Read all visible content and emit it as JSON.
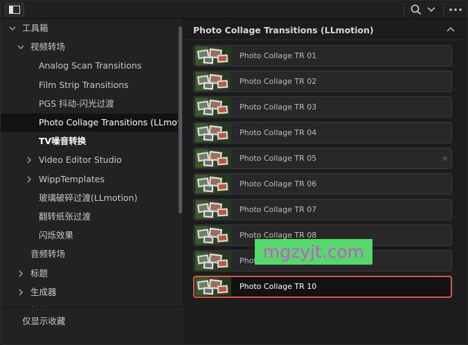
{
  "tree": {
    "items": [
      {
        "label": "工具箱",
        "level": 0,
        "arrow": "down",
        "state": "normal"
      },
      {
        "label": "视频转场",
        "level": 1,
        "arrow": "down",
        "state": "normal"
      },
      {
        "label": "Analog Scan Transitions",
        "level": 2,
        "arrow": "none",
        "state": "normal"
      },
      {
        "label": "Film Strip Transitions",
        "level": 2,
        "arrow": "none",
        "state": "normal"
      },
      {
        "label": "PGS 抖动-闪光过渡",
        "level": 2,
        "arrow": "none",
        "state": "normal"
      },
      {
        "label": "Photo Collage Transitions (LLmoti...",
        "level": 2,
        "arrow": "none",
        "state": "selected"
      },
      {
        "label": "TV噪音转换",
        "level": 2,
        "arrow": "none",
        "state": "bold"
      },
      {
        "label": "Video Editor Studio",
        "level": 2,
        "arrow": "right",
        "state": "normal"
      },
      {
        "label": "WippTemplates",
        "level": 2,
        "arrow": "right",
        "state": "normal"
      },
      {
        "label": "玻璃破碎过渡(LLmotion)",
        "level": 2,
        "arrow": "none",
        "state": "normal"
      },
      {
        "label": "翻转纸张过渡",
        "level": 2,
        "arrow": "none",
        "state": "normal"
      },
      {
        "label": "闪烁效果",
        "level": 2,
        "arrow": "none",
        "state": "normal"
      },
      {
        "label": "音频转场",
        "level": 1,
        "arrow": "none",
        "state": "normal"
      },
      {
        "label": "标题",
        "level": 1,
        "arrow": "right",
        "state": "normal"
      },
      {
        "label": "生成器",
        "level": 1,
        "arrow": "right",
        "state": "normal"
      },
      {
        "label": "特效",
        "level": 1,
        "arrow": "right",
        "state": "normal"
      }
    ],
    "footer_label": "仅显示收藏"
  },
  "panel": {
    "title": "Photo Collage Transitions (LLmotion)",
    "cards": [
      {
        "label": "Photo Collage TR 01",
        "active": false,
        "favorite_visible": false
      },
      {
        "label": "Photo Collage TR 02",
        "active": false,
        "favorite_visible": false
      },
      {
        "label": "Photo Collage TR 03",
        "active": false,
        "favorite_visible": false
      },
      {
        "label": "Photo Collage TR 04",
        "active": false,
        "favorite_visible": false
      },
      {
        "label": "Photo Collage TR 05",
        "active": false,
        "favorite_visible": true
      },
      {
        "label": "Photo Collage TR 06",
        "active": false,
        "favorite_visible": false
      },
      {
        "label": "Photo Collage TR 07",
        "active": false,
        "favorite_visible": false
      },
      {
        "label": "Photo Collage TR 08",
        "active": false,
        "favorite_visible": false
      },
      {
        "label": "Photo Collage TR 09",
        "active": false,
        "favorite_visible": false
      },
      {
        "label": "Photo Collage TR 10",
        "active": true,
        "favorite_visible": false
      }
    ]
  },
  "watermark": {
    "text": "mgzyjt.com"
  },
  "toolbar": {
    "icons": [
      "panel-toggle-icon",
      "search-icon",
      "chevron-down-icon",
      "more-options-icon"
    ]
  },
  "colors": {
    "accent_selection": "#e2574c",
    "watermark_bg": "#55d96a",
    "watermark_text": "#d24fd6"
  }
}
